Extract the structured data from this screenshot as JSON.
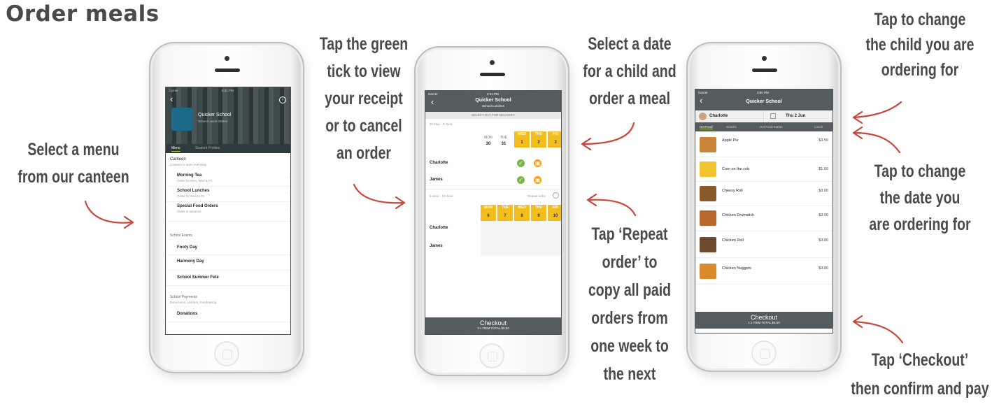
{
  "title": "Order meals",
  "callouts": {
    "select_menu": "Select a menu\nfrom our canteen",
    "green_tick": "Tap the green\ntick to view\nyour receipt\nor to cancel\nan order",
    "select_date": "Select a date\nfor a child and\norder a meal",
    "repeat_order": "Tap ‘Repeat\norder’ to\ncopy all paid\norders from\none week to\nthe next",
    "change_child": "Tap to change\nthe child you are\nordering for",
    "change_date": "Tap to change\nthe date you\nare ordering for",
    "checkout": "Tap ‘Checkout’\nthen confirm and pay"
  },
  "phone1": {
    "status": "Carrier",
    "time": "6:21 PM",
    "school": "Quicker School",
    "school_sub": "School Lunch Orders",
    "tab_menu": "Menu",
    "tab_profiles": "Student Profiles",
    "canteen_title": "Canteen",
    "canteen_sub": "Canteen is open everyday",
    "menus": [
      {
        "name": "Morning Tea",
        "desc": "Order for Mon, Wed & Fri"
      },
      {
        "name": "School Lunches",
        "desc": "Order for Mon to Fri"
      },
      {
        "name": "Special Food Orders",
        "desc": "Order in advance"
      }
    ],
    "school_events": "School Events",
    "events": [
      "Footy Day",
      "Harmony Day",
      "School Summer Fete"
    ],
    "payments_title": "School Payments",
    "payments_sub": "Excursions, Uniform, Fundraising",
    "donations": "Donations"
  },
  "phone2": {
    "status": "Carrier",
    "time": "2:51 PM",
    "school": "Quicker School",
    "sub": "School Lunches",
    "select_day": "SELECT DAY FOR DELIVERY",
    "week1_label": "30 May - 3 June",
    "week1_days": [
      "MON",
      "TUE",
      "WED",
      "THU",
      "FRI"
    ],
    "week1_dates": [
      "30",
      "31",
      "1",
      "2",
      "3"
    ],
    "children": [
      "Charlotte",
      "James"
    ],
    "week2_label": "6 June - 10 June",
    "repeat_label": "Repeat order",
    "week2_days": [
      "MON",
      "TUE",
      "WED",
      "THU",
      "FRI"
    ],
    "week2_dates": [
      "6",
      "7",
      "8",
      "9",
      "10"
    ],
    "checkout": "Checkout",
    "checkout_sub": "3 x ITEM  TOTAL $0.00"
  },
  "phone3": {
    "status": "Carrier",
    "time": "3:50 PM",
    "school": "Quicker School",
    "child": "Charlotte",
    "date": "Thu 2 Jun",
    "tabs": [
      "Hot Food",
      "Snacks",
      "Hot Food Extras",
      "Lunch"
    ],
    "items": [
      {
        "name": "Apple Pie",
        "price": "$3.50",
        "color": "#c9863b"
      },
      {
        "name": "Corn on the cob",
        "price": "$1.50",
        "color": "#f2c12e"
      },
      {
        "name": "Cheesy Roll",
        "price": "$3.00",
        "color": "#8a5a2b"
      },
      {
        "name": "Chicken Drumstick",
        "price": "$3.00",
        "color": "#b9692e"
      },
      {
        "name": "Chicken Roll",
        "price": "$3.80",
        "color": "#6e4a2e"
      },
      {
        "name": "Chicken Nuggets",
        "price": "$3.80",
        "color": "#d98a2d"
      }
    ],
    "checkout": "Checkout",
    "checkout_sub": "1 x ITEM  TOTAL $3.50"
  },
  "colors": {
    "arrow": "#c8473b",
    "accent_yellow": "#f4bd1e",
    "green": "#7ab648",
    "orange": "#f39c12",
    "header": "#555c60"
  }
}
